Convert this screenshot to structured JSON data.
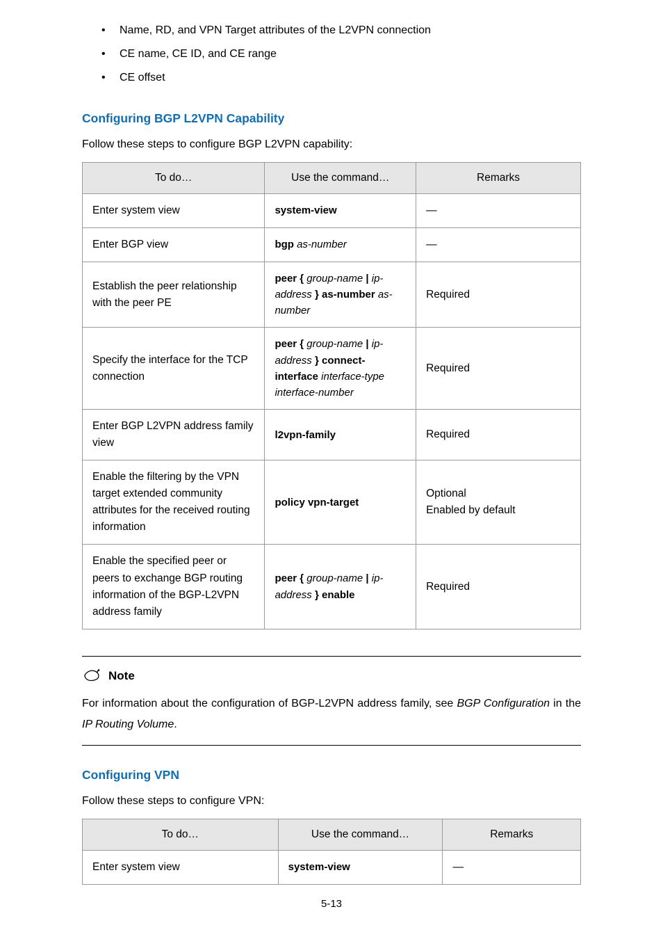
{
  "bullets": [
    "Name, RD, and VPN Target attributes of the L2VPN connection",
    "CE name, CE ID, and CE range",
    "CE offset"
  ],
  "sect1": {
    "heading": "Configuring BGP L2VPN Capability",
    "intro": "Follow these steps to configure BGP L2VPN capability:",
    "header": [
      "To do…",
      "Use the command…",
      "Remarks"
    ],
    "rows": [
      {
        "desc": "Enter system view",
        "cmd": "system-view",
        "rem": "—"
      },
      {
        "desc": "Enter BGP view",
        "cmd_prefix": "bgp ",
        "cmd_param": "as-number",
        "rem": "—"
      },
      {
        "desc": "Establish the peer relationship with the peer PE",
        "seg": [
          "peer { ",
          "group-name",
          " | ",
          "ip-address",
          " } as-number ",
          "as-number"
        ],
        "rem": "Required"
      },
      {
        "desc": "Specify the interface for the TCP connection",
        "seg": [
          "peer { ",
          "group-name",
          " | ",
          "ip-address",
          " } connect-interface ",
          "interface-type interface-number"
        ],
        "rem": "Required"
      },
      {
        "desc": "Enter BGP L2VPN address family view",
        "cmd": "l2vpn-family",
        "rem": "Required"
      },
      {
        "desc": "Enable the filtering by the VPN target extended community attributes for the received routing information",
        "cmd": "policy vpn-target",
        "rem_lines": [
          "Optional",
          "Enabled by default"
        ]
      },
      {
        "desc": "Enable the specified peer or peers to exchange BGP routing information of the BGP-L2VPN address family",
        "seg": [
          "peer { ",
          "group-name",
          " | ",
          "ip-address",
          " } enable"
        ],
        "rem": "Required"
      }
    ]
  },
  "note": {
    "label": "Note",
    "line1_parts": [
      "For  information  about  the  configuration  of  BGP-L2VPN  address  family,  see  ",
      "BGP ",
      "Configuration",
      " in the ",
      "IP Routing Volume",
      "."
    ]
  },
  "sect2": {
    "heading": "Configuring VPN",
    "intro": "Follow these steps to configure VPN:",
    "header": [
      "To do…",
      "Use the command…",
      "Remarks"
    ],
    "rows": [
      {
        "desc": "Enter system view",
        "cmd": "system-view",
        "rem": "—"
      }
    ]
  },
  "page_number": "5-13"
}
